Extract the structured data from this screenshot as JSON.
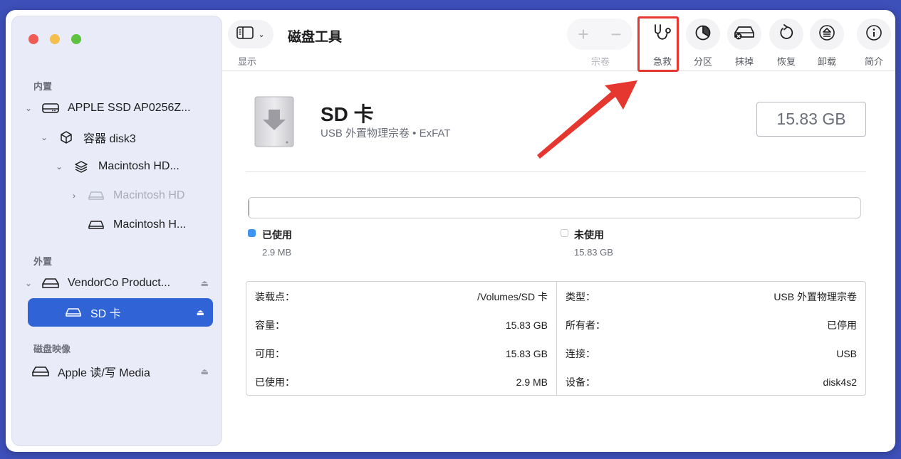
{
  "window": {
    "title": "磁盘工具"
  },
  "toolbar": {
    "view_label": "显示",
    "volume_label": "宗卷",
    "volume_add": "+",
    "volume_remove": "−",
    "buttons": [
      {
        "id": "first-aid",
        "label": "急救",
        "icon": "stethoscope-icon"
      },
      {
        "id": "partition",
        "label": "分区",
        "icon": "pie-chart-icon"
      },
      {
        "id": "erase",
        "label": "抹掉",
        "icon": "erase-disk-icon"
      },
      {
        "id": "restore",
        "label": "恢复",
        "icon": "restore-icon"
      },
      {
        "id": "unmount",
        "label": "卸载",
        "icon": "eject-icon"
      },
      {
        "id": "info",
        "label": "简介",
        "icon": "info-icon"
      }
    ]
  },
  "sidebar": {
    "sections": {
      "internal": "内置",
      "external": "外置",
      "disk_images": "磁盘映像"
    },
    "items": [
      {
        "label": "APPLE SSD AP0256Z...",
        "icon": "internal-drive-icon"
      },
      {
        "label": "容器 disk3",
        "icon": "container-cube-icon"
      },
      {
        "label": "Macintosh HD...",
        "icon": "volume-stack-icon"
      },
      {
        "label": "Macintosh HD",
        "icon": "drive-icon"
      },
      {
        "label": "Macintosh H...",
        "icon": "drive-icon"
      },
      {
        "label": "VendorCo Product...",
        "icon": "external-drive-icon"
      },
      {
        "label": "SD 卡",
        "icon": "drive-icon"
      },
      {
        "label": "Apple 读/写 Media",
        "icon": "external-drive-icon"
      }
    ]
  },
  "disk": {
    "name": "SD 卡",
    "subtitle": "USB 外置物理宗卷 • ExFAT",
    "size": "15.83 GB",
    "used_fraction": 0.0002
  },
  "legend": {
    "used_label": "已使用",
    "used_value": "2.9 MB",
    "free_label": "未使用",
    "free_value": "15.83 GB",
    "used_color": "#3d95f0"
  },
  "info": {
    "left": [
      {
        "key": "装载点：",
        "value": "/Volumes/SD 卡"
      },
      {
        "key": "容量：",
        "value": "15.83 GB"
      },
      {
        "key": "可用：",
        "value": "15.83 GB"
      },
      {
        "key": "已使用：",
        "value": "2.9 MB"
      }
    ],
    "right": [
      {
        "key": "类型：",
        "value": "USB 外置物理宗卷"
      },
      {
        "key": "所有者：",
        "value": "已停用"
      },
      {
        "key": "连接：",
        "value": "USB"
      },
      {
        "key": "设备：",
        "value": "disk4s2"
      }
    ]
  },
  "colors": {
    "selection": "#2f63d6",
    "annotation": "#e5362f"
  }
}
